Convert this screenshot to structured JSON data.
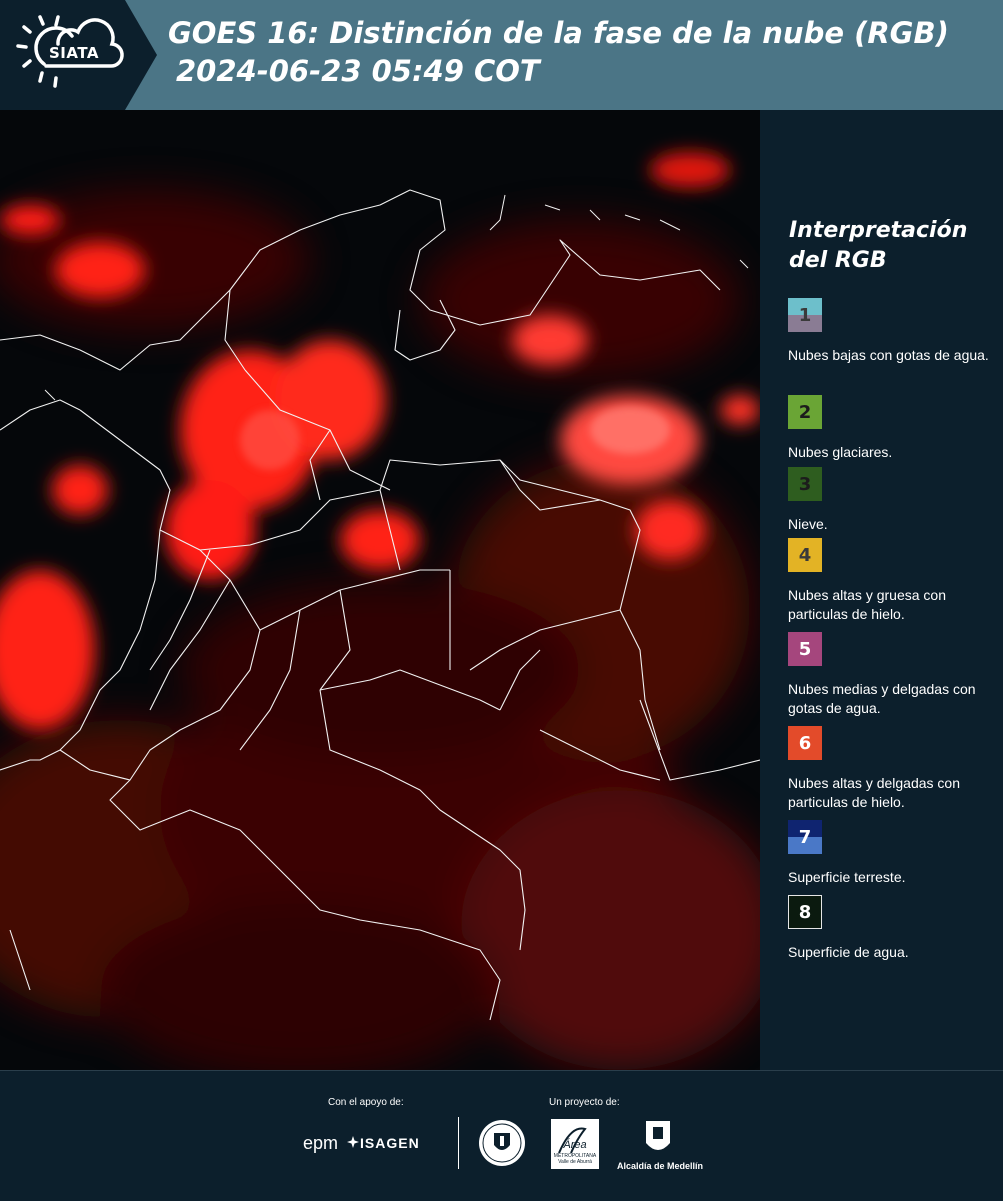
{
  "header": {
    "logo_text": "SIATA",
    "title_line1": "GOES 16: Distinción de la fase de la nube (RGB)",
    "title_line2": "2024-06-23 05:49 COT"
  },
  "legend": {
    "title": "Interpretación del RGB",
    "items": [
      {
        "number": "1",
        "label": "Nubes bajas con gotas de agua.",
        "color_top": "#6dbfcb",
        "color_bottom": "#8a7c94"
      },
      {
        "number": "2",
        "label": "Nubes glaciares.",
        "color_top": "#6aa535",
        "color_bottom": "#6aa535"
      },
      {
        "number": "3",
        "label": "Nieve.",
        "color_top": "#2e5d1f",
        "color_bottom": "#2e5d1f"
      },
      {
        "number": "4",
        "label": "Nubes altas y gruesa con particulas de hielo.",
        "color_top": "#e3b325",
        "color_bottom": "#e3b325"
      },
      {
        "number": "5",
        "label": "Nubes medias y delgadas con gotas de agua.",
        "color_top": "#a5467d",
        "color_bottom": "#a5467d"
      },
      {
        "number": "6",
        "label": "Nubes altas y delgadas con particulas de hielo.",
        "color_top": "#e34b2a",
        "color_bottom": "#e34b2a"
      },
      {
        "number": "7",
        "label": "Superficie terreste.",
        "color_top": "#0f2470",
        "color_bottom": "#4a78c7"
      },
      {
        "number": "8",
        "label": "Superficie de agua.",
        "color_top": "#0b1a0f",
        "color_bottom": "#0b1a0f"
      }
    ]
  },
  "footer": {
    "support_label": "Con el apoyo de:",
    "project_label": "Un proyecto de:",
    "sponsor1": "epm",
    "sponsor2": "ISAGEN",
    "partner_area_line1": "Área",
    "partner_area_line2": "METROPOLITANA",
    "partner_area_line3": "Valle de Aburrá",
    "partner_alcaldia": "Alcaldía de Medellín"
  },
  "colors": {
    "header_bg": "#4b7586",
    "logo_bg": "#0c1f2c",
    "panel_bg": "#0c1f2c",
    "cloud_red": "#ff1a10"
  }
}
